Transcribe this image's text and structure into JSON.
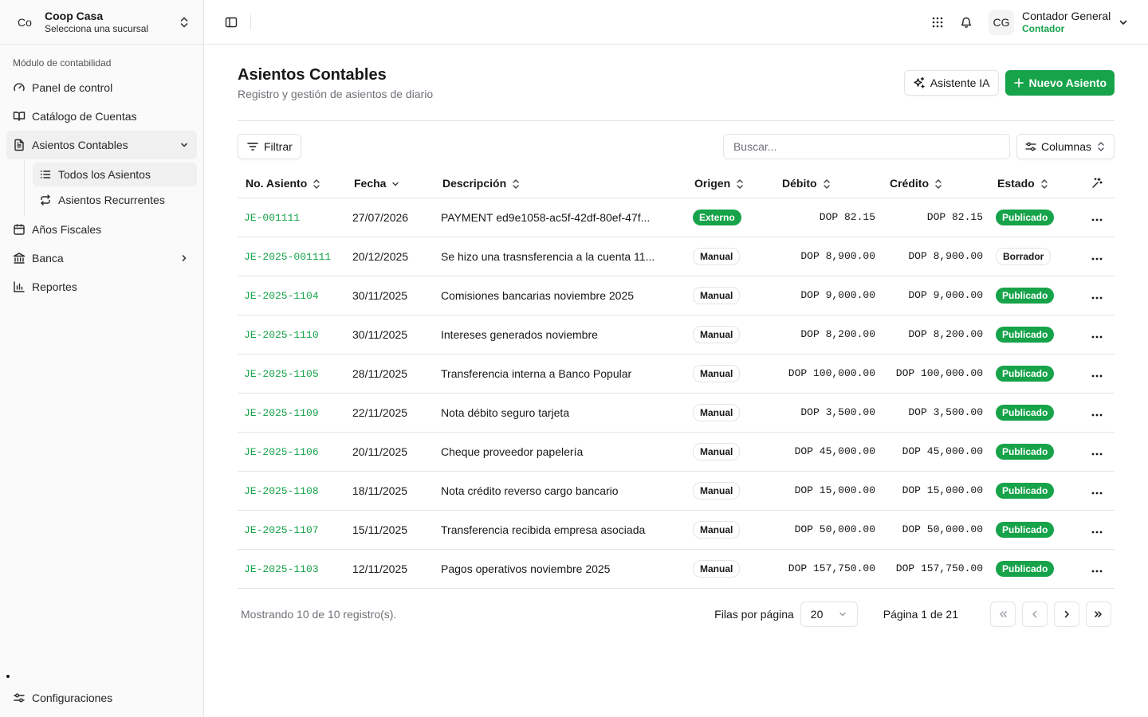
{
  "org": {
    "avatar": "Co",
    "name": "Coop Casa",
    "subtitle": "Selecciona una sucursal"
  },
  "sidebar": {
    "section_label": "Módulo de contabilidad",
    "items": [
      {
        "label": "Panel de control",
        "icon": "gauge-icon"
      },
      {
        "label": "Catálogo de Cuentas",
        "icon": "book-open-icon"
      },
      {
        "label": "Asientos Contables",
        "icon": "file-text-icon"
      },
      {
        "label": "Años Fiscales",
        "icon": "calendar-icon"
      },
      {
        "label": "Banca",
        "icon": "bank-icon"
      },
      {
        "label": "Reportes",
        "icon": "bar-chart-icon"
      }
    ],
    "subitems": [
      {
        "label": "Todos los Asientos",
        "icon": "list-icon"
      },
      {
        "label": "Asientos Recurrentes",
        "icon": "repeat-icon"
      }
    ],
    "settings_label": "Configuraciones"
  },
  "user": {
    "initials": "CG",
    "name": "Contador General",
    "role": "Contador"
  },
  "header": {
    "title": "Asientos Contables",
    "subtitle": "Registro y gestión de asientos de diario",
    "ai_button": "Asistente IA",
    "new_button": "Nuevo Asiento"
  },
  "toolbar": {
    "filter_label": "Filtrar",
    "search_placeholder": "Buscar...",
    "columns_label": "Columnas"
  },
  "table": {
    "columns": [
      "No. Asiento",
      "Fecha",
      "Descripción",
      "Origen",
      "Débito",
      "Crédito",
      "Estado"
    ],
    "rows": [
      {
        "id": "JE-001111",
        "date": "27/07/2026",
        "desc": "PAYMENT ed9e1058-ac5f-42df-80ef-47f...",
        "origin": "Externo",
        "debit": "DOP 82.15",
        "credit": "DOP 82.15",
        "status": "Publicado"
      },
      {
        "id": "JE-2025-001111",
        "date": "20/12/2025",
        "desc": "Se hizo una trasnsferencia a la cuenta 11...",
        "origin": "Manual",
        "debit": "DOP 8,900.00",
        "credit": "DOP 8,900.00",
        "status": "Borrador"
      },
      {
        "id": "JE-2025-1104",
        "date": "30/11/2025",
        "desc": "Comisiones bancarias noviembre 2025",
        "origin": "Manual",
        "debit": "DOP 9,000.00",
        "credit": "DOP 9,000.00",
        "status": "Publicado"
      },
      {
        "id": "JE-2025-1110",
        "date": "30/11/2025",
        "desc": "Intereses generados noviembre",
        "origin": "Manual",
        "debit": "DOP 8,200.00",
        "credit": "DOP 8,200.00",
        "status": "Publicado"
      },
      {
        "id": "JE-2025-1105",
        "date": "28/11/2025",
        "desc": "Transferencia interna a Banco Popular",
        "origin": "Manual",
        "debit": "DOP 100,000.00",
        "credit": "DOP 100,000.00",
        "status": "Publicado"
      },
      {
        "id": "JE-2025-1109",
        "date": "22/11/2025",
        "desc": "Nota débito seguro tarjeta",
        "origin": "Manual",
        "debit": "DOP 3,500.00",
        "credit": "DOP 3,500.00",
        "status": "Publicado"
      },
      {
        "id": "JE-2025-1106",
        "date": "20/11/2025",
        "desc": "Cheque proveedor papelería",
        "origin": "Manual",
        "debit": "DOP 45,000.00",
        "credit": "DOP 45,000.00",
        "status": "Publicado"
      },
      {
        "id": "JE-2025-1108",
        "date": "18/11/2025",
        "desc": "Nota crédito reverso cargo bancario",
        "origin": "Manual",
        "debit": "DOP 15,000.00",
        "credit": "DOP 15,000.00",
        "status": "Publicado"
      },
      {
        "id": "JE-2025-1107",
        "date": "15/11/2025",
        "desc": "Transferencia recibida empresa asociada",
        "origin": "Manual",
        "debit": "DOP 50,000.00",
        "credit": "DOP 50,000.00",
        "status": "Publicado"
      },
      {
        "id": "JE-2025-1103",
        "date": "12/11/2025",
        "desc": "Pagos operativos noviembre 2025",
        "origin": "Manual",
        "debit": "DOP 157,750.00",
        "credit": "DOP 157,750.00",
        "status": "Publicado"
      }
    ]
  },
  "footer": {
    "info": "Mostrando 10 de 10 registro(s).",
    "rows_label": "Filas por página",
    "rows_value": "20",
    "page_label": "Página 1 de 21"
  },
  "colors": {
    "accent": "#16a34a",
    "border": "#e4e4e7",
    "muted": "#71717a"
  }
}
